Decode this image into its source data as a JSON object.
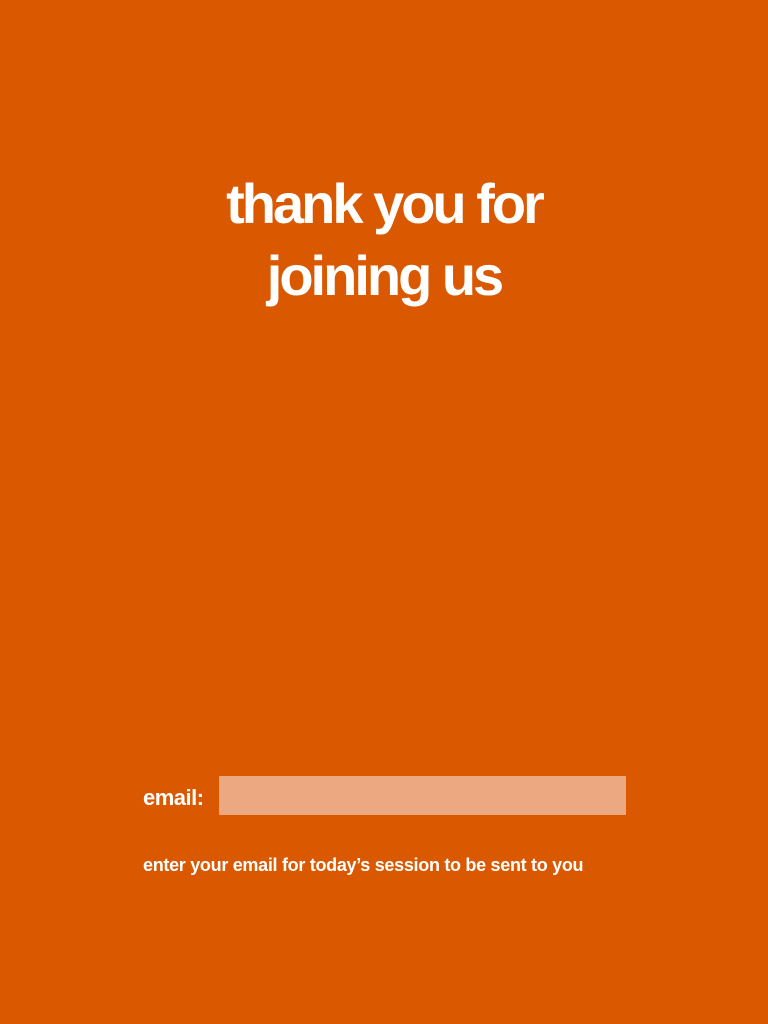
{
  "colors": {
    "background": "#D95800",
    "text": "#FFFFFF",
    "input_background": "#ECA981"
  },
  "headline": {
    "line1": "thank you for",
    "line2": "joining us"
  },
  "email_form": {
    "label": "email:",
    "value": "",
    "placeholder": ""
  },
  "hint": "enter your email for today’s session to be sent to you"
}
